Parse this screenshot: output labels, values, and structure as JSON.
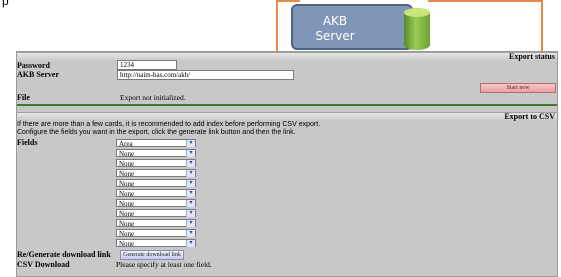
{
  "background": {
    "fragment_text": "p",
    "server_label_line1": "AKB",
    "server_label_line2": "Server"
  },
  "export_status": {
    "header": "Export status",
    "password_label": "Password",
    "password_value": "1234",
    "akb_label": "AKB Server",
    "akb_value": "http://naim-bas.com/akb/",
    "start_button": "Start new",
    "file_label": "File",
    "file_value": "Export not initialized."
  },
  "export_csv": {
    "header": "Export to CSV",
    "info_line1": "If there are more than a few cards, it is recommended to add index before performing CSV export.",
    "info_line2": "Configure the fields you want in the export, click the generate link button and then the link.",
    "fields_label": "Fields",
    "fields": [
      "Area",
      "None",
      "None",
      "None",
      "None",
      "None",
      "None",
      "None",
      "None",
      "None",
      "None"
    ],
    "regen_label": "Re/Generate download link",
    "regen_button": "Generate download link",
    "csv_label": "CSV Download",
    "csv_value": "Please specify at least one field."
  }
}
